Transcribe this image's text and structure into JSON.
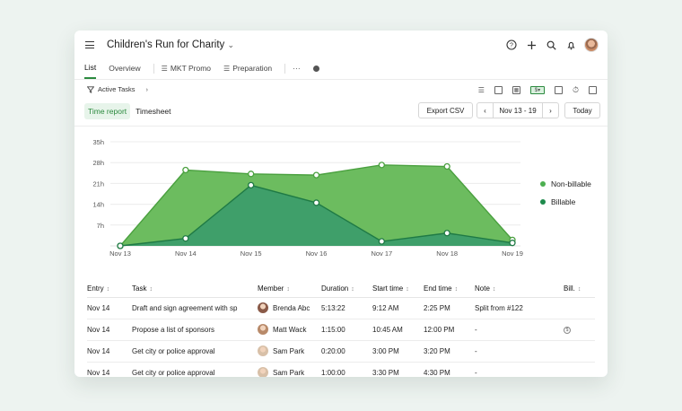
{
  "project": {
    "title": "Children's Run for Charity"
  },
  "tabs": [
    {
      "label": "List",
      "active": true
    },
    {
      "label": "Overview",
      "active": false
    },
    {
      "label": "MKT Promo",
      "active": false
    },
    {
      "label": "Preparation",
      "active": false
    }
  ],
  "tabs_more": "···",
  "filter": {
    "label": "Active Tasks"
  },
  "report_toggle": {
    "time_report": "Time report",
    "timesheet": "Timesheet"
  },
  "toolbar": {
    "export": "Export CSV",
    "date_range": "Nov 13 - 19",
    "prev": "‹",
    "next": "›",
    "today": "Today"
  },
  "colors": {
    "accent": "#2b8a3e",
    "non_billable": "#5cb85c",
    "billable": "#2e8b57"
  },
  "chart_data": {
    "type": "area",
    "categories": [
      "Nov 13",
      "Nov 14",
      "Nov 15",
      "Nov 16",
      "Nov 17",
      "Nov 18",
      "Nov 19"
    ],
    "y_ticks": [
      "35h",
      "28h",
      "21h",
      "14h",
      "7h"
    ],
    "ylim": [
      0,
      35
    ],
    "series": [
      {
        "name": "Non-billable",
        "values": [
          0,
          25.5,
          24.2,
          23.8,
          27.2,
          26.7,
          2.0
        ],
        "color": "#6cbc5f"
      },
      {
        "name": "Billable",
        "values": [
          0,
          2.5,
          20.4,
          14.5,
          1.5,
          4.3,
          1.0
        ],
        "color": "#3f9f6a"
      }
    ],
    "legend": "right",
    "grid": true
  },
  "table": {
    "columns": [
      "Entry",
      "Task",
      "Member",
      "Duration",
      "Start time",
      "End time",
      "Note",
      "Bill."
    ],
    "rows": [
      {
        "entry": "Nov 14",
        "task": "Draft and sign agreement with sp",
        "member": "Brenda Abc",
        "duration": "5:13:22",
        "start": "9:12 AM",
        "end": "2:25 PM",
        "note": "Split from #122",
        "bill": "",
        "avatar": "#8a5a48"
      },
      {
        "entry": "Nov 14",
        "task": "Propose a list of sponsors",
        "member": "Matt Wack",
        "duration": "1:15:00",
        "start": "10:45 AM",
        "end": "12:00 PM",
        "note": "-",
        "bill": "$",
        "avatar": "#b88a6a"
      },
      {
        "entry": "Nov 14",
        "task": "Get city or police approval",
        "member": "Sam Park",
        "duration": "0:20:00",
        "start": "3:00 PM",
        "end": "3:20 PM",
        "note": "-",
        "bill": "",
        "avatar": "#d8c0a8"
      },
      {
        "entry": "Nov 14",
        "task": "Get city or police approval",
        "member": "Sam Park",
        "duration": "1:00:00",
        "start": "3:30 PM",
        "end": "4:30 PM",
        "note": "-",
        "bill": "",
        "avatar": "#d8c0a8"
      }
    ]
  }
}
